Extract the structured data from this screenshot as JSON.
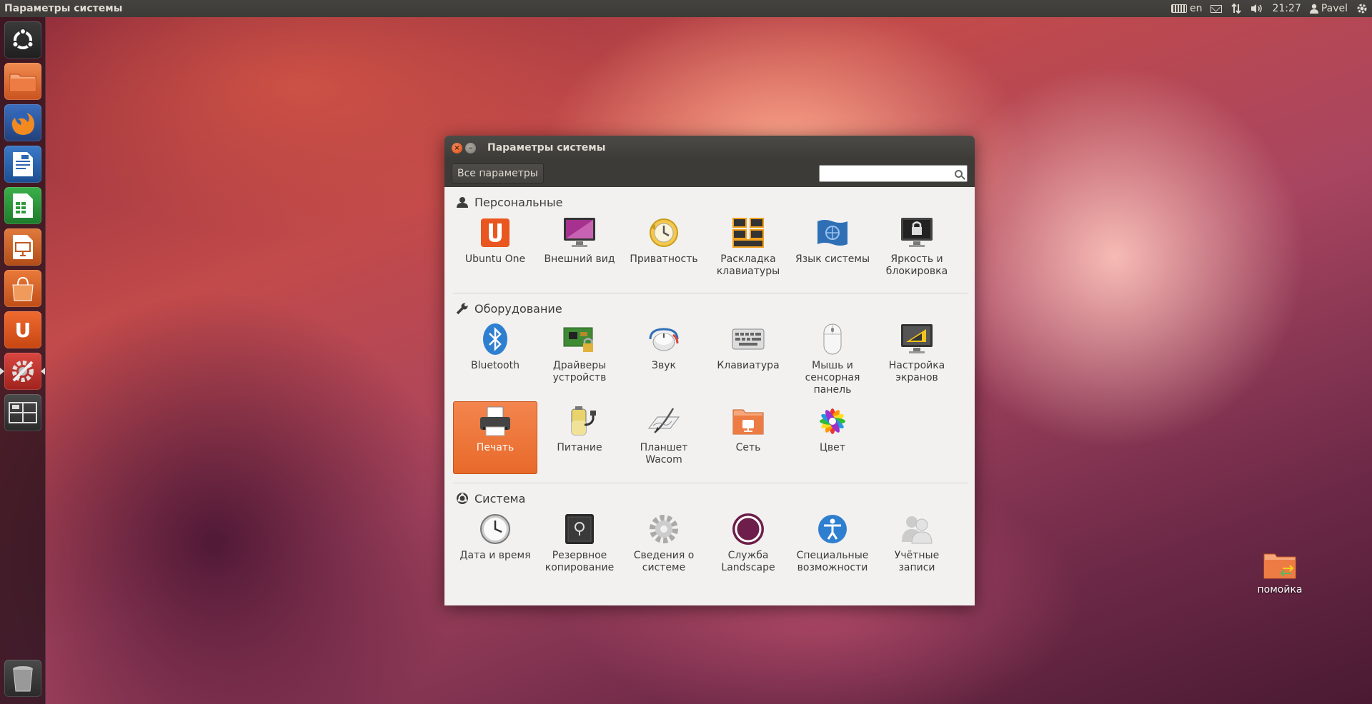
{
  "top_panel": {
    "title": "Параметры системы",
    "keyboard_layout": "en",
    "time": "21:27",
    "user": "Pavel"
  },
  "launcher": {
    "items": [
      "dash",
      "files",
      "firefox",
      "writer",
      "calc",
      "impress",
      "software-center",
      "ubuntu-one",
      "system-settings",
      "workspaces",
      "trash"
    ]
  },
  "window": {
    "title": "Параметры системы",
    "all_settings_label": "Все параметры",
    "search_placeholder": ""
  },
  "sections": {
    "personal": {
      "title": "Персональные",
      "items": [
        "Ubuntu One",
        "Внешний вид",
        "Приватность",
        "Раскладка клавиатуры",
        "Язык системы",
        "Яркость и блокировка"
      ]
    },
    "hardware": {
      "title": "Оборудование",
      "items": [
        "Bluetooth",
        "Драйверы устройств",
        "Звук",
        "Клавиатура",
        "Мышь и сенсорная панель",
        "Настройка экранов",
        "Печать",
        "Питание",
        "Планшет Wacom",
        "Сеть",
        "Цвет"
      ]
    },
    "system": {
      "title": "Система",
      "items": [
        "Дата и время",
        "Резервное копирование",
        "Сведения о системе",
        "Служба Landscape",
        "Специальные возможности",
        "Учётные записи"
      ]
    }
  },
  "desktop": {
    "trash_folder_label": "помойка"
  },
  "colors": {
    "accent": "#e86a2a",
    "panel": "#3c3b37"
  }
}
